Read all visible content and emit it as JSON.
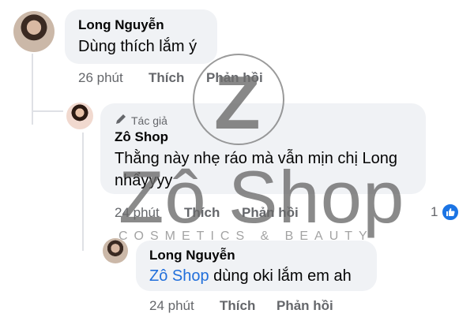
{
  "comments": [
    {
      "author": "Long Nguyễn",
      "lines": [
        "Dùng thích lắm ý"
      ],
      "time": "26 phút",
      "like_label": "Thích",
      "reply_label": "Phản hồi"
    },
    {
      "author_badge": "Tác giả",
      "author": "Zô Shop",
      "lines": [
        "Thằng này nhẹ ráo mà vẫn mịn chị Long",
        "nhẩyyyy"
      ],
      "time": "24 phút",
      "like_label": "Thích",
      "reply_label": "Phản hồi",
      "reaction_count": "1"
    },
    {
      "author": "Long Nguyễn",
      "mention": "Zô Shop",
      "text_after_mention": " dùng oki lắm em ah",
      "time": "24 phút",
      "like_label": "Thích",
      "reply_label": "Phản hồi"
    }
  ],
  "watermark": {
    "mark": "Z",
    "name": "Zô Shop",
    "tagline": "COSMETICS & BEAUTY"
  },
  "colors": {
    "bubble": "#f0f2f5",
    "meta_text": "#65676b",
    "mention": "#216fdb",
    "like_badge": "#1b74e4"
  },
  "icons": {
    "author_badge": "pen-icon",
    "reaction": "thumbs-up-icon"
  }
}
